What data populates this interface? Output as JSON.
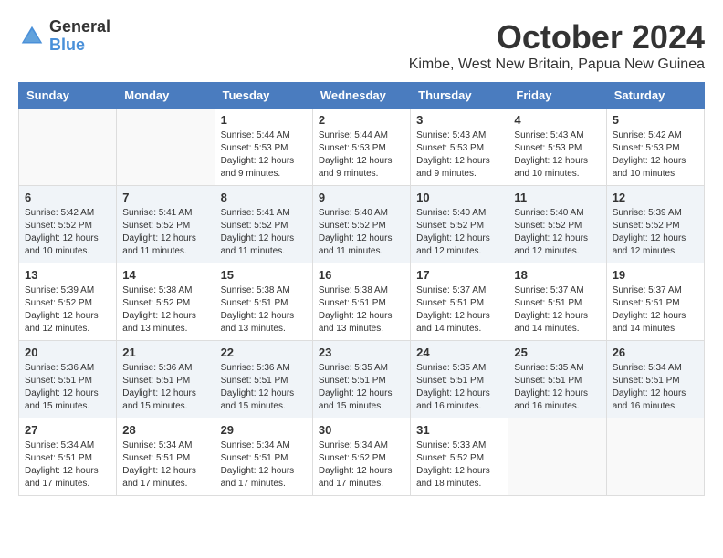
{
  "header": {
    "logo_line1": "General",
    "logo_line2": "Blue",
    "month_year": "October 2024",
    "location": "Kimbe, West New Britain, Papua New Guinea"
  },
  "weekdays": [
    "Sunday",
    "Monday",
    "Tuesday",
    "Wednesday",
    "Thursday",
    "Friday",
    "Saturday"
  ],
  "weeks": [
    [
      {
        "day": "",
        "sunrise": "",
        "sunset": "",
        "daylight": ""
      },
      {
        "day": "",
        "sunrise": "",
        "sunset": "",
        "daylight": ""
      },
      {
        "day": "1",
        "sunrise": "Sunrise: 5:44 AM",
        "sunset": "Sunset: 5:53 PM",
        "daylight": "Daylight: 12 hours and 9 minutes."
      },
      {
        "day": "2",
        "sunrise": "Sunrise: 5:44 AM",
        "sunset": "Sunset: 5:53 PM",
        "daylight": "Daylight: 12 hours and 9 minutes."
      },
      {
        "day": "3",
        "sunrise": "Sunrise: 5:43 AM",
        "sunset": "Sunset: 5:53 PM",
        "daylight": "Daylight: 12 hours and 9 minutes."
      },
      {
        "day": "4",
        "sunrise": "Sunrise: 5:43 AM",
        "sunset": "Sunset: 5:53 PM",
        "daylight": "Daylight: 12 hours and 10 minutes."
      },
      {
        "day": "5",
        "sunrise": "Sunrise: 5:42 AM",
        "sunset": "Sunset: 5:53 PM",
        "daylight": "Daylight: 12 hours and 10 minutes."
      }
    ],
    [
      {
        "day": "6",
        "sunrise": "Sunrise: 5:42 AM",
        "sunset": "Sunset: 5:52 PM",
        "daylight": "Daylight: 12 hours and 10 minutes."
      },
      {
        "day": "7",
        "sunrise": "Sunrise: 5:41 AM",
        "sunset": "Sunset: 5:52 PM",
        "daylight": "Daylight: 12 hours and 11 minutes."
      },
      {
        "day": "8",
        "sunrise": "Sunrise: 5:41 AM",
        "sunset": "Sunset: 5:52 PM",
        "daylight": "Daylight: 12 hours and 11 minutes."
      },
      {
        "day": "9",
        "sunrise": "Sunrise: 5:40 AM",
        "sunset": "Sunset: 5:52 PM",
        "daylight": "Daylight: 12 hours and 11 minutes."
      },
      {
        "day": "10",
        "sunrise": "Sunrise: 5:40 AM",
        "sunset": "Sunset: 5:52 PM",
        "daylight": "Daylight: 12 hours and 12 minutes."
      },
      {
        "day": "11",
        "sunrise": "Sunrise: 5:40 AM",
        "sunset": "Sunset: 5:52 PM",
        "daylight": "Daylight: 12 hours and 12 minutes."
      },
      {
        "day": "12",
        "sunrise": "Sunrise: 5:39 AM",
        "sunset": "Sunset: 5:52 PM",
        "daylight": "Daylight: 12 hours and 12 minutes."
      }
    ],
    [
      {
        "day": "13",
        "sunrise": "Sunrise: 5:39 AM",
        "sunset": "Sunset: 5:52 PM",
        "daylight": "Daylight: 12 hours and 12 minutes."
      },
      {
        "day": "14",
        "sunrise": "Sunrise: 5:38 AM",
        "sunset": "Sunset: 5:52 PM",
        "daylight": "Daylight: 12 hours and 13 minutes."
      },
      {
        "day": "15",
        "sunrise": "Sunrise: 5:38 AM",
        "sunset": "Sunset: 5:51 PM",
        "daylight": "Daylight: 12 hours and 13 minutes."
      },
      {
        "day": "16",
        "sunrise": "Sunrise: 5:38 AM",
        "sunset": "Sunset: 5:51 PM",
        "daylight": "Daylight: 12 hours and 13 minutes."
      },
      {
        "day": "17",
        "sunrise": "Sunrise: 5:37 AM",
        "sunset": "Sunset: 5:51 PM",
        "daylight": "Daylight: 12 hours and 14 minutes."
      },
      {
        "day": "18",
        "sunrise": "Sunrise: 5:37 AM",
        "sunset": "Sunset: 5:51 PM",
        "daylight": "Daylight: 12 hours and 14 minutes."
      },
      {
        "day": "19",
        "sunrise": "Sunrise: 5:37 AM",
        "sunset": "Sunset: 5:51 PM",
        "daylight": "Daylight: 12 hours and 14 minutes."
      }
    ],
    [
      {
        "day": "20",
        "sunrise": "Sunrise: 5:36 AM",
        "sunset": "Sunset: 5:51 PM",
        "daylight": "Daylight: 12 hours and 15 minutes."
      },
      {
        "day": "21",
        "sunrise": "Sunrise: 5:36 AM",
        "sunset": "Sunset: 5:51 PM",
        "daylight": "Daylight: 12 hours and 15 minutes."
      },
      {
        "day": "22",
        "sunrise": "Sunrise: 5:36 AM",
        "sunset": "Sunset: 5:51 PM",
        "daylight": "Daylight: 12 hours and 15 minutes."
      },
      {
        "day": "23",
        "sunrise": "Sunrise: 5:35 AM",
        "sunset": "Sunset: 5:51 PM",
        "daylight": "Daylight: 12 hours and 15 minutes."
      },
      {
        "day": "24",
        "sunrise": "Sunrise: 5:35 AM",
        "sunset": "Sunset: 5:51 PM",
        "daylight": "Daylight: 12 hours and 16 minutes."
      },
      {
        "day": "25",
        "sunrise": "Sunrise: 5:35 AM",
        "sunset": "Sunset: 5:51 PM",
        "daylight": "Daylight: 12 hours and 16 minutes."
      },
      {
        "day": "26",
        "sunrise": "Sunrise: 5:34 AM",
        "sunset": "Sunset: 5:51 PM",
        "daylight": "Daylight: 12 hours and 16 minutes."
      }
    ],
    [
      {
        "day": "27",
        "sunrise": "Sunrise: 5:34 AM",
        "sunset": "Sunset: 5:51 PM",
        "daylight": "Daylight: 12 hours and 17 minutes."
      },
      {
        "day": "28",
        "sunrise": "Sunrise: 5:34 AM",
        "sunset": "Sunset: 5:51 PM",
        "daylight": "Daylight: 12 hours and 17 minutes."
      },
      {
        "day": "29",
        "sunrise": "Sunrise: 5:34 AM",
        "sunset": "Sunset: 5:51 PM",
        "daylight": "Daylight: 12 hours and 17 minutes."
      },
      {
        "day": "30",
        "sunrise": "Sunrise: 5:34 AM",
        "sunset": "Sunset: 5:52 PM",
        "daylight": "Daylight: 12 hours and 17 minutes."
      },
      {
        "day": "31",
        "sunrise": "Sunrise: 5:33 AM",
        "sunset": "Sunset: 5:52 PM",
        "daylight": "Daylight: 12 hours and 18 minutes."
      },
      {
        "day": "",
        "sunrise": "",
        "sunset": "",
        "daylight": ""
      },
      {
        "day": "",
        "sunrise": "",
        "sunset": "",
        "daylight": ""
      }
    ]
  ]
}
